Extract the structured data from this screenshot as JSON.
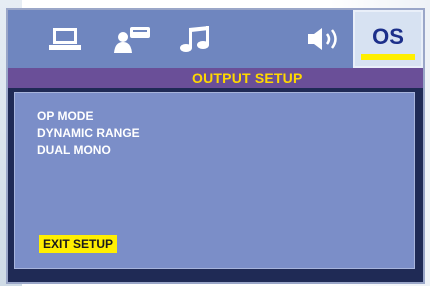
{
  "tabs": [
    {
      "name": "laptop-icon",
      "label": ""
    },
    {
      "name": "speaker-person-icon",
      "label": ""
    },
    {
      "name": "music-note-icon",
      "label": ""
    },
    {
      "name": "volume-icon",
      "label": ""
    },
    {
      "name": "os-tab",
      "label": "OS"
    }
  ],
  "header": {
    "subtitle": "OUTPUT  SETUP"
  },
  "menu": {
    "items": [
      "OP MODE",
      "DYNAMIC RANGE",
      "DUAL MONO"
    ],
    "exit_label": "EXIT SETUP"
  },
  "colors": {
    "topbar": "#6f86bf",
    "subbar": "#6a4f98",
    "panel": "#7b8ec8",
    "accent": "#ffef00",
    "os_tab_bg": "#d7e2f2",
    "os_text": "#1c2f8a"
  }
}
